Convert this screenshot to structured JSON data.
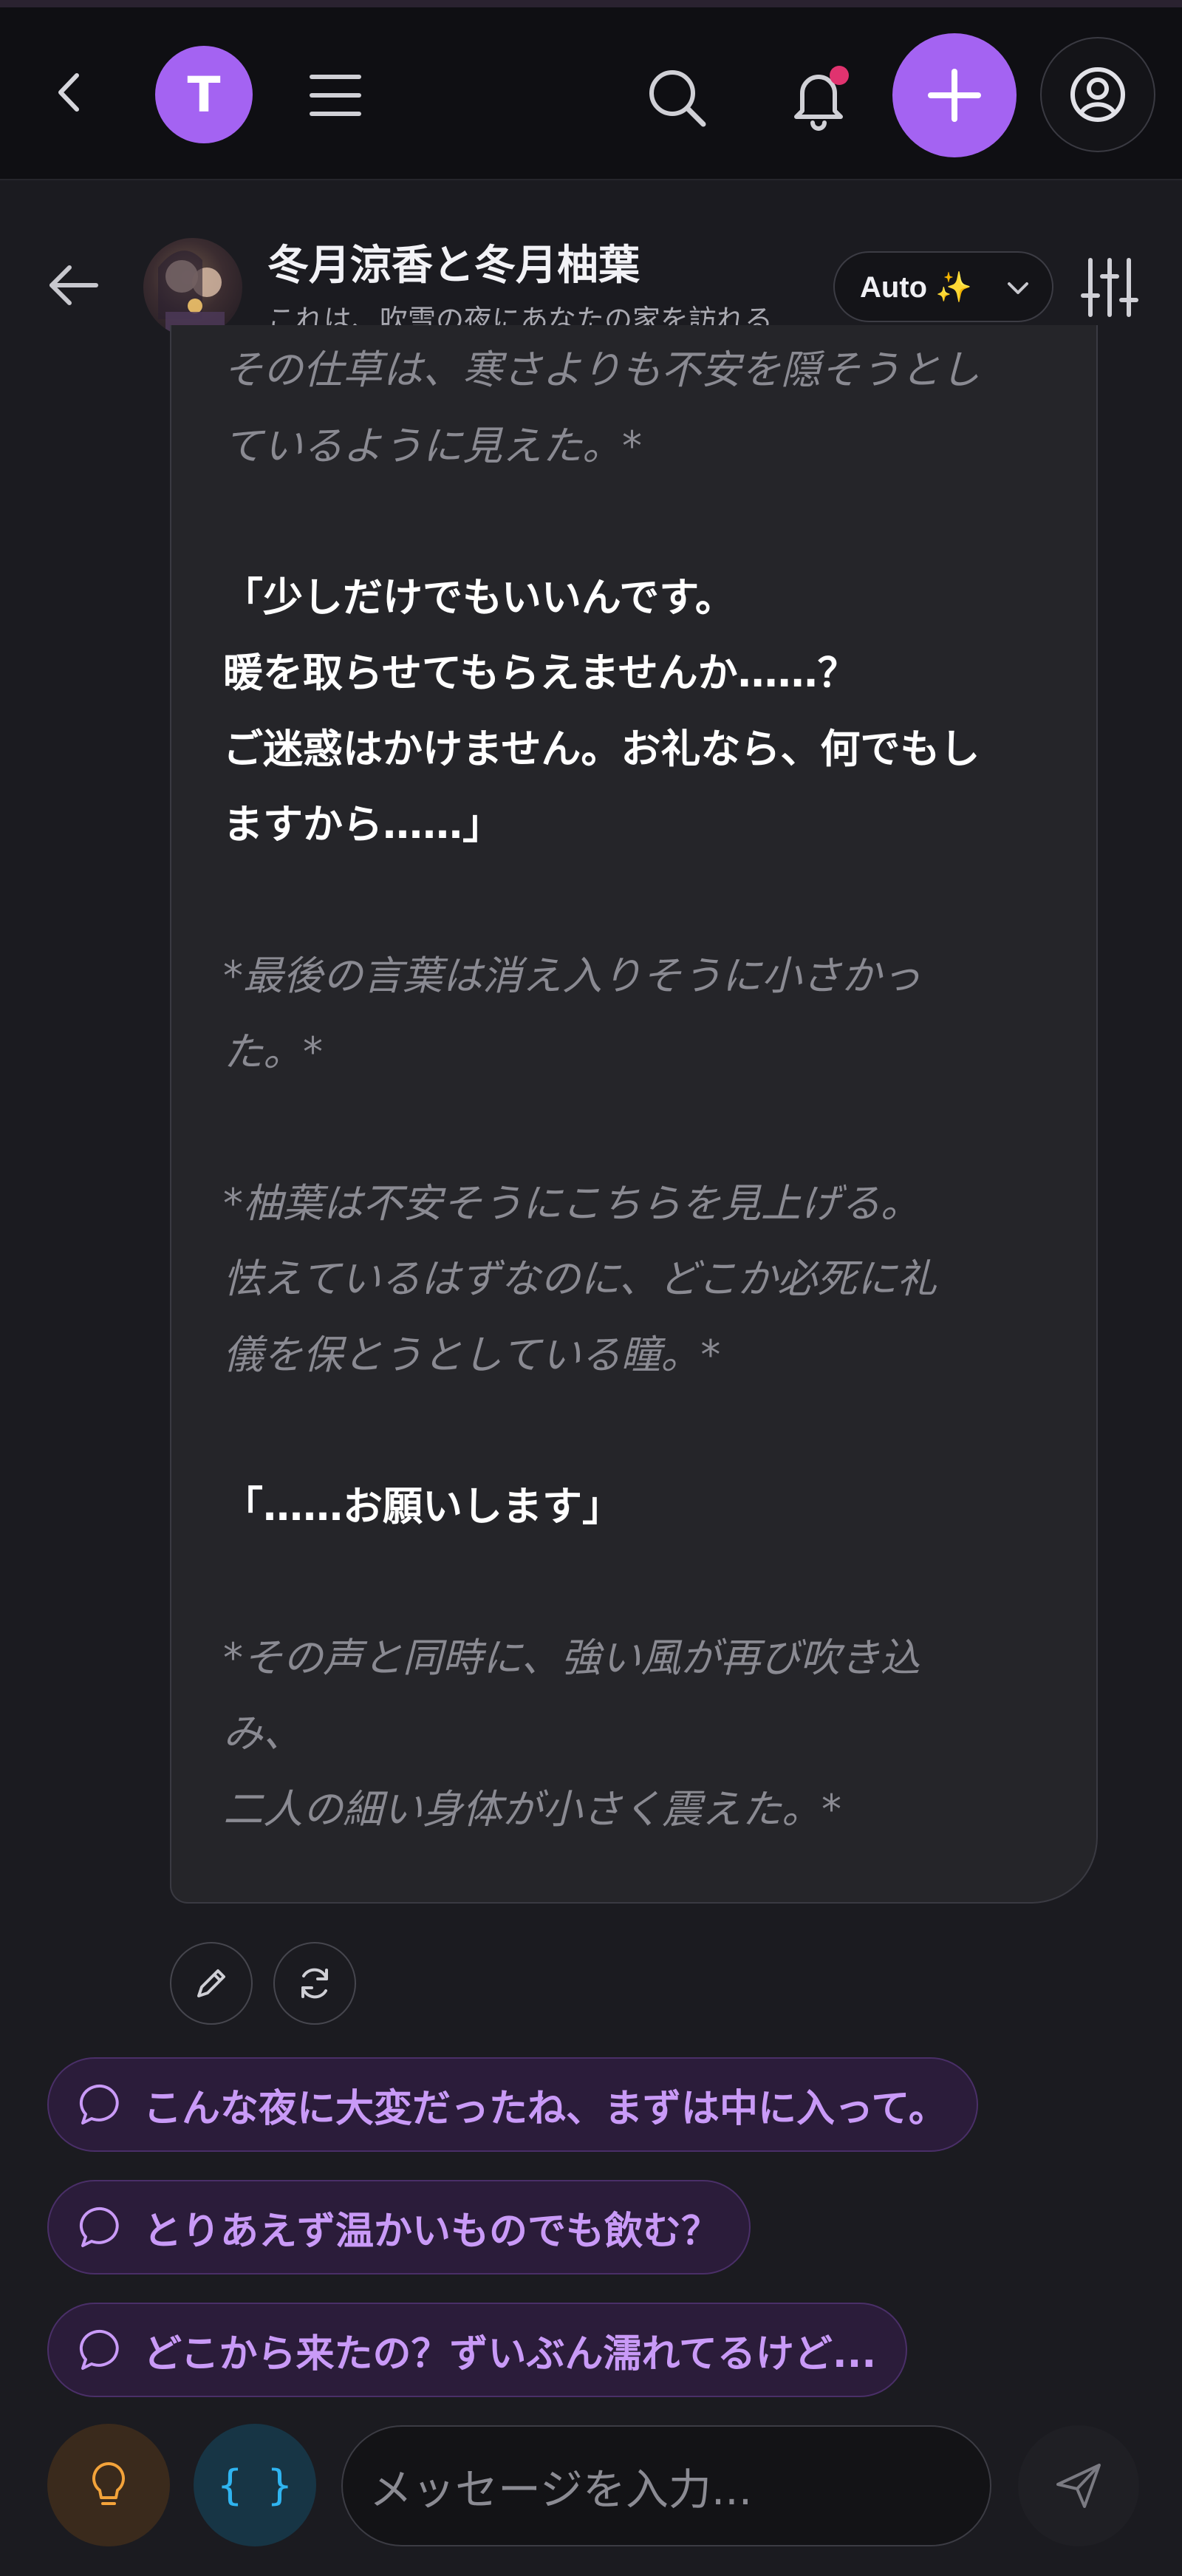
{
  "topbar": {
    "avatar_letter": "T"
  },
  "chat": {
    "title": "冬月涼香と冬月柚葉",
    "subtitle": "これは、吹雪の夜にあなたの家を訪れる...",
    "model_select": "Auto ✨"
  },
  "message": {
    "lines": [
      {
        "text": "その仕草は、寒さよりも不安を隠そうとし",
        "style": "em"
      },
      {
        "text": "ているように見えた。*",
        "style": "em"
      },
      {
        "text": "",
        "style": "em"
      },
      {
        "text": "「少しだけでもいいんです。",
        "style": "sp"
      },
      {
        "text": "暖を取らせてもらえませんか……？",
        "style": "sp"
      },
      {
        "text": "ご迷惑はかけません。お礼なら、何でもし",
        "style": "sp"
      },
      {
        "text": "ますから……」",
        "style": "sp"
      },
      {
        "text": "",
        "style": "em"
      },
      {
        "text": "*最後の言葉は消え入りそうに小さかっ",
        "style": "em"
      },
      {
        "text": "た。*",
        "style": "em"
      },
      {
        "text": "",
        "style": "em"
      },
      {
        "text": "*柚葉は不安そうにこちらを見上げる。",
        "style": "em"
      },
      {
        "text": "怯えているはずなのに、どこか必死に礼",
        "style": "em"
      },
      {
        "text": "儀を保とうとしている瞳。*",
        "style": "em"
      },
      {
        "text": "",
        "style": "em"
      },
      {
        "text": "「……お願いします」",
        "style": "sp"
      },
      {
        "text": "",
        "style": "em"
      },
      {
        "text": "*その声と同時に、強い風が再び吹き込",
        "style": "em"
      },
      {
        "text": "み、",
        "style": "em"
      },
      {
        "text": "二人の細い身体が小さく震えた。*",
        "style": "em"
      }
    ]
  },
  "suggestions": [
    "こんな夜に大変だったね、まずは中に入って。",
    "とりあえず温かいものでも飲む？",
    "どこから来たの？ずいぶん濡れてるけど..."
  ],
  "input": {
    "placeholder": "メッセージを入力..."
  },
  "colors": {
    "accent": "#a463f2",
    "notification_dot": "#e0336f",
    "suggestion_text": "#c99af7"
  }
}
